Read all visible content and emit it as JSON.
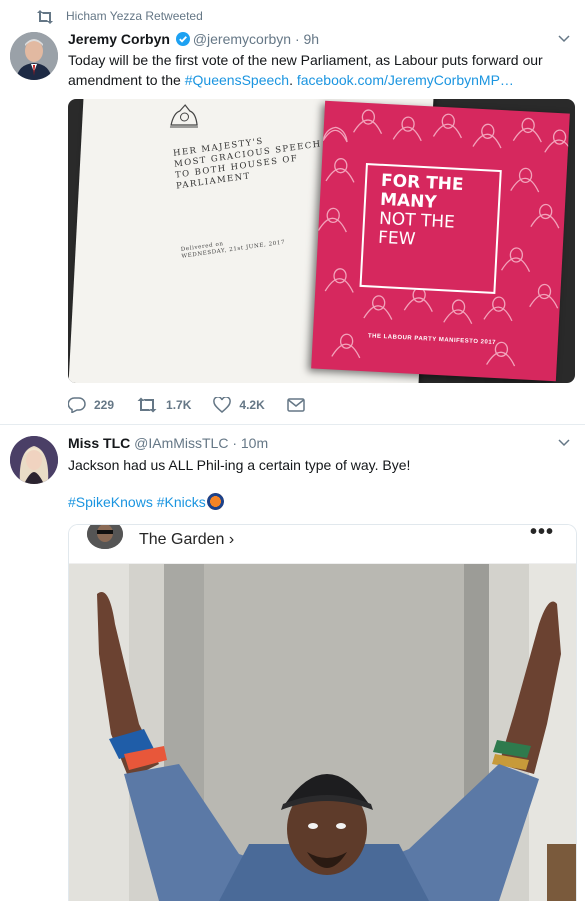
{
  "retweet": {
    "label": "Hicham Yezza Retweeted"
  },
  "tweet1": {
    "name": "Jeremy Corbyn",
    "handle": "@jeremycorbyn",
    "time": "· 9h",
    "text_before": "Today will be the first vote of the new Parliament, as Labour puts forward our amendment to the ",
    "hashtag": "#QueensSpeech",
    "text_between": ". ",
    "link": "facebook.com/JeremyCorbynMP…",
    "image": {
      "speech_lines": [
        "HER MAJESTY'S",
        "MOST GRACIOUS SPEECH",
        "TO BOTH HOUSES OF",
        "PARLIAMENT"
      ],
      "delivered_lines": [
        "Delivered on",
        "WEDNESDAY, 21st JUNE, 2017"
      ],
      "manifesto_lines": [
        "FOR THE",
        "MANY",
        "NOT THE",
        "FEW"
      ],
      "manifesto_footer": "THE LABOUR PARTY MANIFESTO 2017"
    },
    "replies": "229",
    "retweets": "1.7K",
    "likes": "4.2K"
  },
  "tweet2": {
    "name": "Miss TLC",
    "handle": "@IAmMissTLC",
    "time": "· 10m",
    "text": "Jackson had us ALL Phil-ing a certain type of way. Bye!",
    "hashtag1": "#SpikeKnows",
    "hashtag2": "#Knicks",
    "card_title": "The Garden ›",
    "card_menu": "•••"
  },
  "colors": {
    "link": "#1b95e0",
    "muted": "#657786",
    "verified": "#1da1f2",
    "manifesto": "#d6285e"
  }
}
